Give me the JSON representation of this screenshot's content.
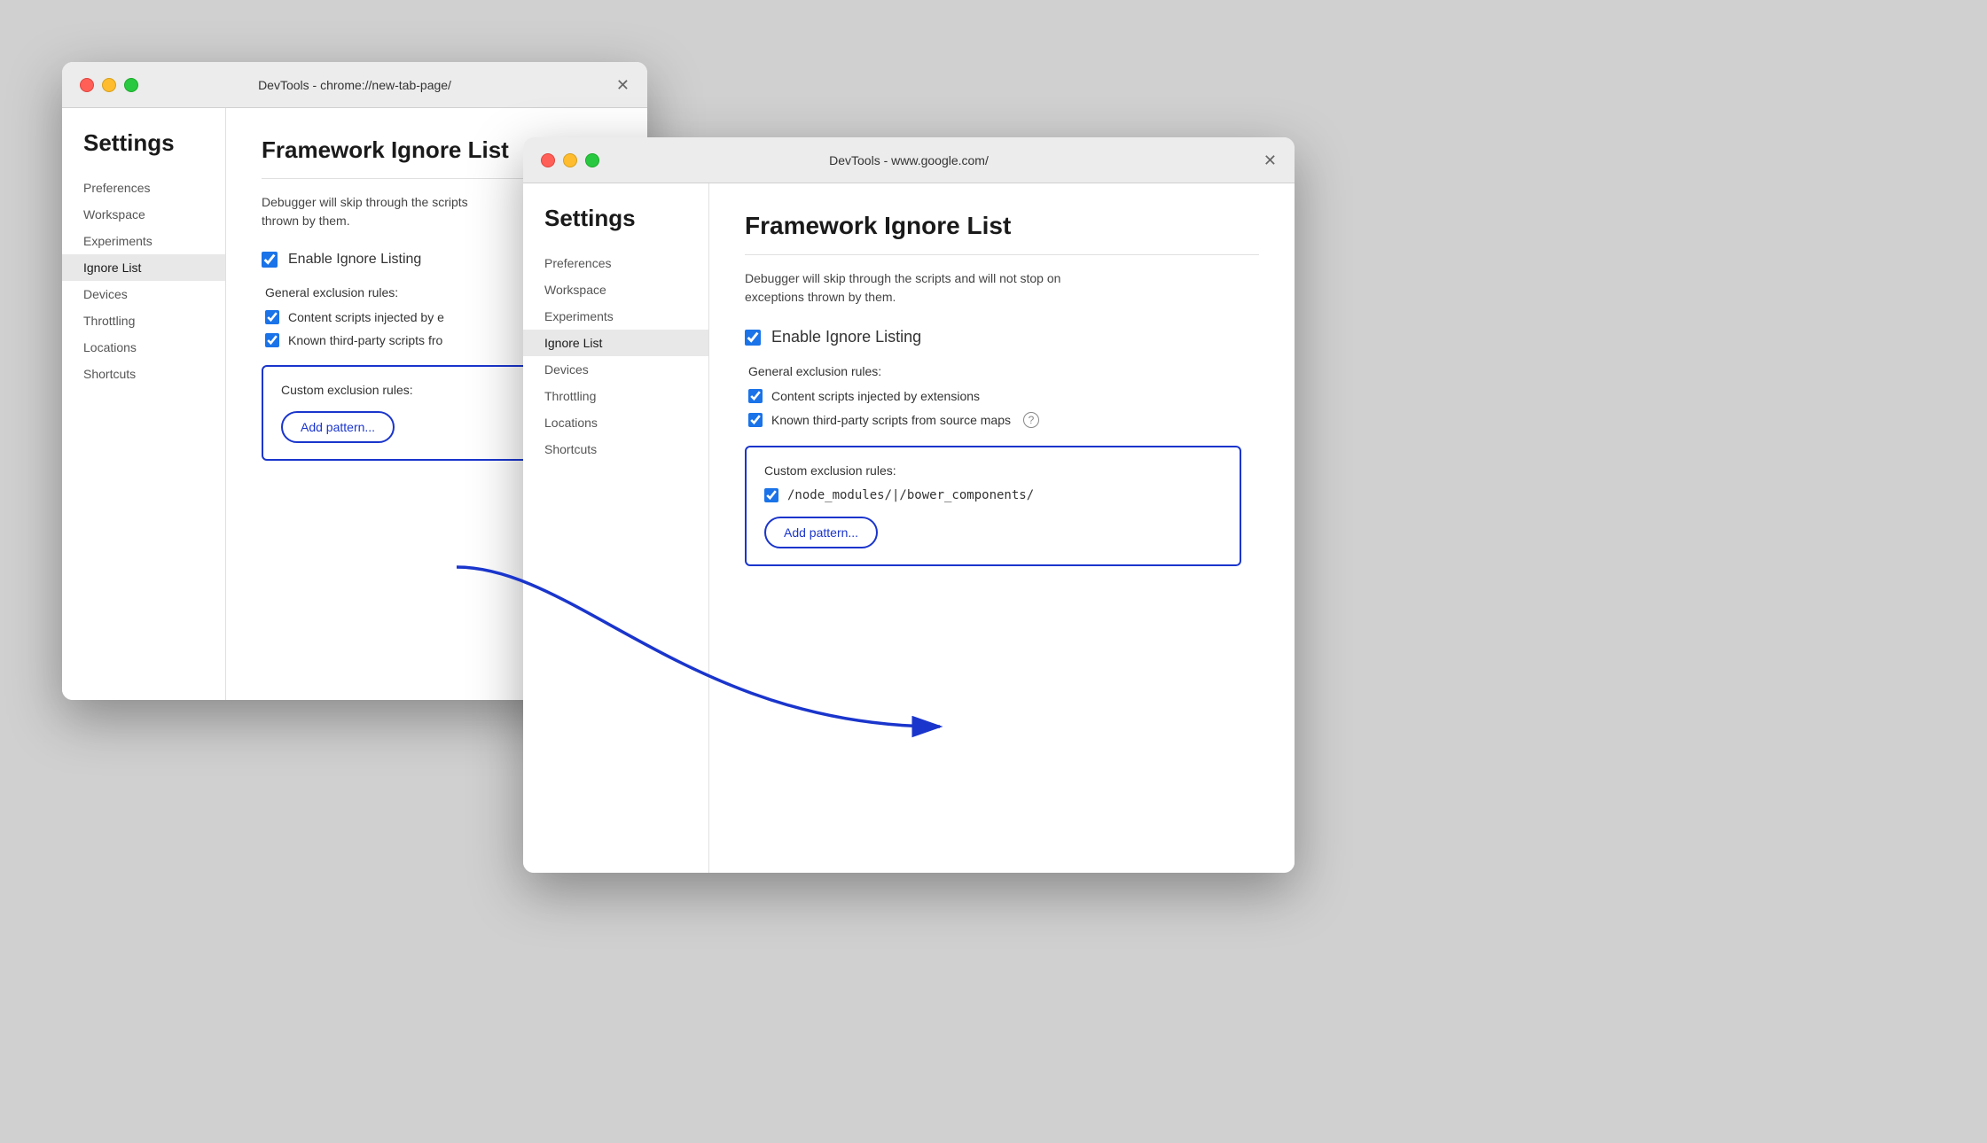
{
  "window1": {
    "title": "DevTools - chrome://new-tab-page/",
    "sidebar": {
      "heading": "Settings",
      "items": [
        {
          "label": "Preferences",
          "active": false
        },
        {
          "label": "Workspace",
          "active": false
        },
        {
          "label": "Experiments",
          "active": false
        },
        {
          "label": "Ignore List",
          "active": true
        },
        {
          "label": "Devices",
          "active": false
        },
        {
          "label": "Throttling",
          "active": false
        },
        {
          "label": "Locations",
          "active": false
        },
        {
          "label": "Shortcuts",
          "active": false
        }
      ]
    },
    "content": {
      "title": "Framework Ignore List",
      "description": "Debugger will skip through the scripts\nthrown by them.",
      "enableCheckboxLabel": "Enable Ignore Listing",
      "sectionLabel": "General exclusion rules:",
      "rule1": "Content scripts injected by e",
      "rule2": "Known third-party scripts fro",
      "customBox": {
        "title": "Custom exclusion rules:",
        "addPatternLabel": "Add pattern..."
      }
    }
  },
  "window2": {
    "title": "DevTools - www.google.com/",
    "sidebar": {
      "heading": "Settings",
      "items": [
        {
          "label": "Preferences",
          "active": false
        },
        {
          "label": "Workspace",
          "active": false
        },
        {
          "label": "Experiments",
          "active": false
        },
        {
          "label": "Ignore List",
          "active": true
        },
        {
          "label": "Devices",
          "active": false
        },
        {
          "label": "Throttling",
          "active": false
        },
        {
          "label": "Locations",
          "active": false
        },
        {
          "label": "Shortcuts",
          "active": false
        }
      ]
    },
    "content": {
      "title": "Framework Ignore List",
      "description": "Debugger will skip through the scripts and will not stop on\nexceptions thrown by them.",
      "enableCheckboxLabel": "Enable Ignore Listing",
      "sectionLabel": "General exclusion rules:",
      "rule1": "Content scripts injected by extensions",
      "rule2": "Known third-party scripts from source maps",
      "customBox": {
        "title": "Custom exclusion rules:",
        "customRule": "/node_modules/|/bower_components/",
        "addPatternLabel": "Add pattern..."
      }
    }
  },
  "colors": {
    "blue": "#1a35cc",
    "accent": "#1a73e8"
  }
}
